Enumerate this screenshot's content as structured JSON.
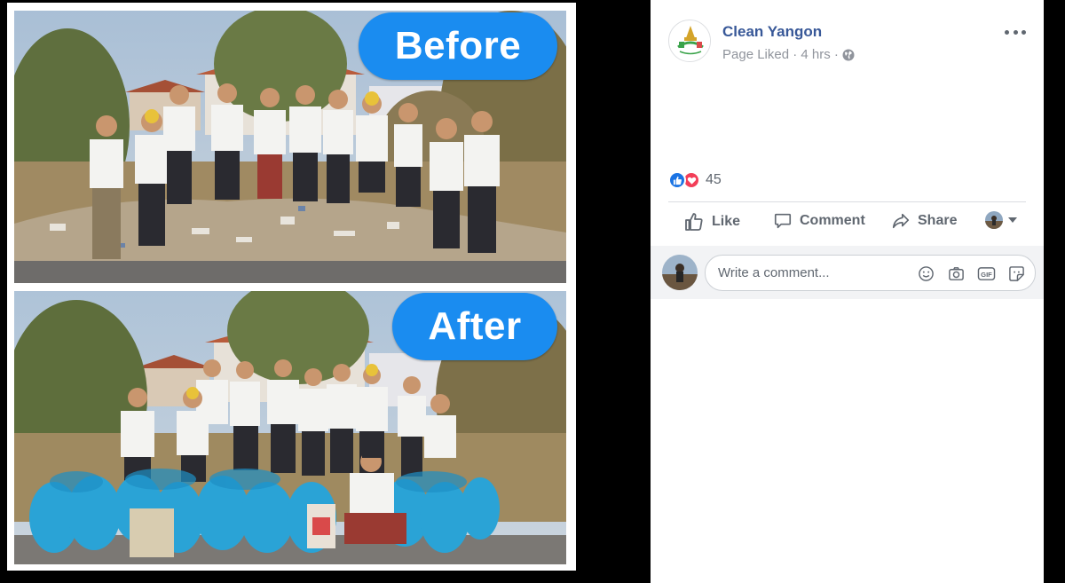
{
  "photo": {
    "before_label": "Before",
    "after_label": "After"
  },
  "post": {
    "page_name": "Clean Yangon",
    "meta": "Page Liked · 4 hrs ·",
    "more_icon": "more-horizontal-icon",
    "reaction_count": "45",
    "reactions": [
      "like-reaction-icon",
      "love-reaction-icon"
    ]
  },
  "actions": {
    "like": "Like",
    "comment": "Comment",
    "share": "Share"
  },
  "comment": {
    "placeholder": "Write a comment...",
    "tools": [
      "emoji-icon",
      "camera-icon",
      "gif-icon",
      "sticker-icon"
    ]
  },
  "colors": {
    "brand_link": "#385898",
    "pill_blue": "#1a8cf0",
    "like_blue": "#1b74e4",
    "love_red": "#f33e58"
  }
}
